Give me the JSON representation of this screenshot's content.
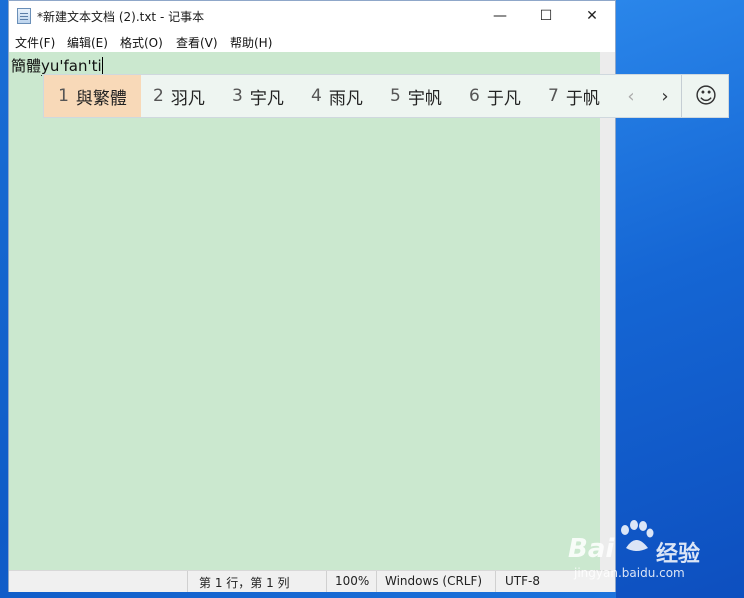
{
  "window": {
    "title": "*新建文本文档 (2).txt - 记事本",
    "minimize_glyph": "—",
    "maximize_glyph": "☐",
    "close_glyph": "✕"
  },
  "menu": [
    {
      "label": "文件(F)"
    },
    {
      "label": "编辑(E)"
    },
    {
      "label": "格式(O)"
    },
    {
      "label": "查看(V)"
    },
    {
      "label": "帮助(H)"
    }
  ],
  "editor": {
    "committed_text": "簡體",
    "composing_text": "yu'fan'ti"
  },
  "ime": {
    "candidates": [
      {
        "num": "1",
        "text": "與繁體",
        "selected": true
      },
      {
        "num": "2",
        "text": "羽凡"
      },
      {
        "num": "3",
        "text": "宇凡"
      },
      {
        "num": "4",
        "text": "雨凡"
      },
      {
        "num": "5",
        "text": "宇帆"
      },
      {
        "num": "6",
        "text": "于凡"
      },
      {
        "num": "7",
        "text": "于帆"
      }
    ],
    "prev_glyph": "‹",
    "next_glyph": "›",
    "emoji_glyph": "☺"
  },
  "status": {
    "position": "第 1 行，第 1 列",
    "zoom": "100%",
    "line_ending": "Windows (CRLF)",
    "encoding": "UTF-8"
  },
  "watermark": {
    "brand": "Bai",
    "brand_cn": "经验",
    "url": "jingyan.baidu.com"
  }
}
